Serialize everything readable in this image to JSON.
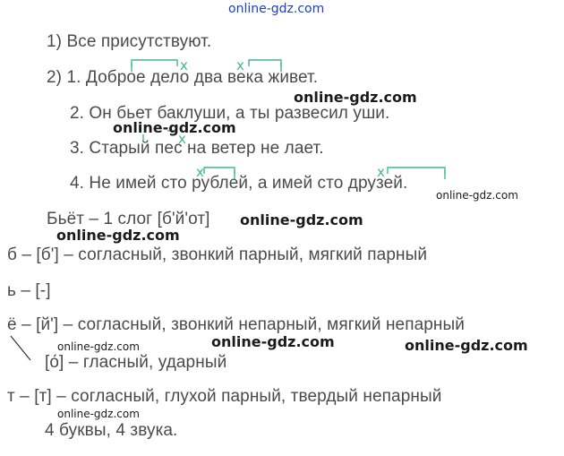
{
  "watermark": "online-gdz.com",
  "lines": {
    "l1": "1) Все присутствуют.",
    "l2": "2) 1. Доброе дело два века живет.",
    "l3": "2. Он бьет баклуши, а ты развесил уши.",
    "l4": "3. Старый пес на ветер не лает.",
    "l5": "4. Не имей сто рублей, а имей сто друзей.",
    "l6": "Бьёт – 1 слог [б'й'от]",
    "l7": "б – [б'] – согласный, звонкий парный, мягкий парный",
    "l8": "ь – [-]",
    "l9": "ё – [й'] – согласный, звонкий непарный, мягкий непарный",
    "l10": "[о́] – гласный, ударный",
    "l11": "т – [т] – согласный, глухой парный, твердый непарный",
    "l12": "4 буквы, 4 звука."
  },
  "marks": {
    "x": "x"
  },
  "colors": {
    "text": "#4a4a4a",
    "marks": "#3dbb8a",
    "watermark_top": "#1d3fc4"
  }
}
